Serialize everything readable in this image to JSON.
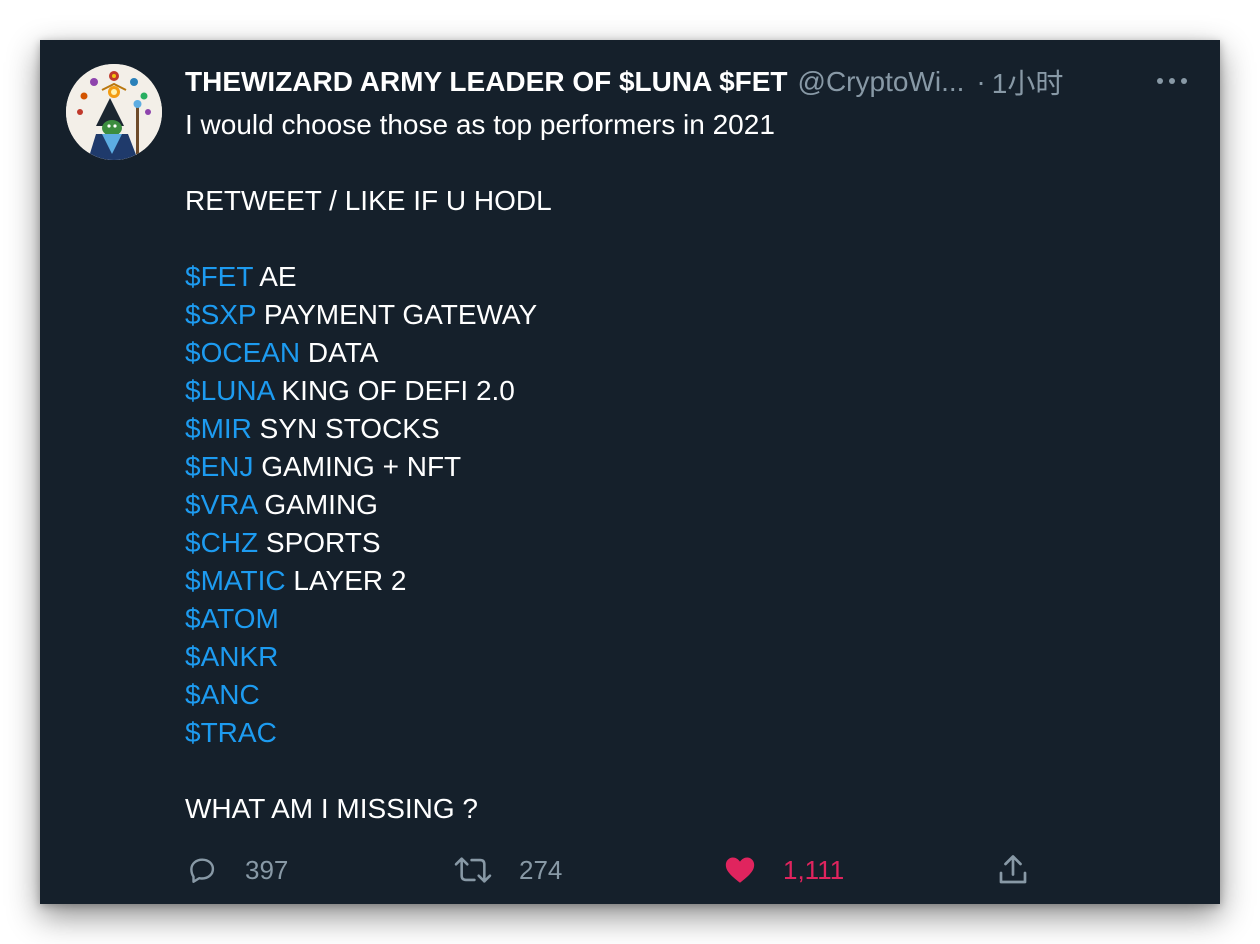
{
  "tweet": {
    "author_name": "THEWIZARD ARMY LEADER OF $LUNA $FET",
    "handle": "@CryptoWi...",
    "separator": "·",
    "time": "1小时",
    "lines": [
      {
        "type": "text",
        "text": "I would choose those as top performers in 2021"
      },
      {
        "type": "blank"
      },
      {
        "type": "text",
        "text": "RETWEET / LIKE IF U HODL"
      },
      {
        "type": "blank"
      },
      {
        "type": "tag",
        "tag": "$FET",
        "text": " AE"
      },
      {
        "type": "tag",
        "tag": "$SXP",
        "text": " PAYMENT GATEWAY"
      },
      {
        "type": "tag",
        "tag": "$OCEAN",
        "text": " DATA"
      },
      {
        "type": "tag",
        "tag": "$LUNA",
        "text": " KING OF DEFI 2.0"
      },
      {
        "type": "tag",
        "tag": "$MIR",
        "text": " SYN STOCKS"
      },
      {
        "type": "tag",
        "tag": "$ENJ",
        "text": " GAMING + NFT"
      },
      {
        "type": "tag",
        "tag": "$VRA",
        "text": " GAMING"
      },
      {
        "type": "tag",
        "tag": "$CHZ",
        "text": " SPORTS"
      },
      {
        "type": "tag",
        "tag": "$MATIC",
        "text": " LAYER 2"
      },
      {
        "type": "tag",
        "tag": "$ATOM",
        "text": ""
      },
      {
        "type": "tag",
        "tag": "$ANKR",
        "text": ""
      },
      {
        "type": "tag",
        "tag": "$ANC",
        "text": ""
      },
      {
        "type": "tag",
        "tag": "$TRAC",
        "text": ""
      },
      {
        "type": "blank"
      },
      {
        "type": "text",
        "text": "WHAT AM I MISSING ?"
      }
    ],
    "actions": {
      "reply": {
        "icon": "reply-icon",
        "count": "397"
      },
      "retweet": {
        "icon": "retweet-icon",
        "count": "274"
      },
      "like": {
        "icon": "heart-icon",
        "count": "1,111",
        "liked": true
      },
      "share": {
        "icon": "share-icon"
      }
    },
    "colors": {
      "background": "#15202b",
      "text": "#ffffff",
      "secondary": "#8899a6",
      "cashtag": "#1d9bf0",
      "like": "#e0245e"
    }
  }
}
